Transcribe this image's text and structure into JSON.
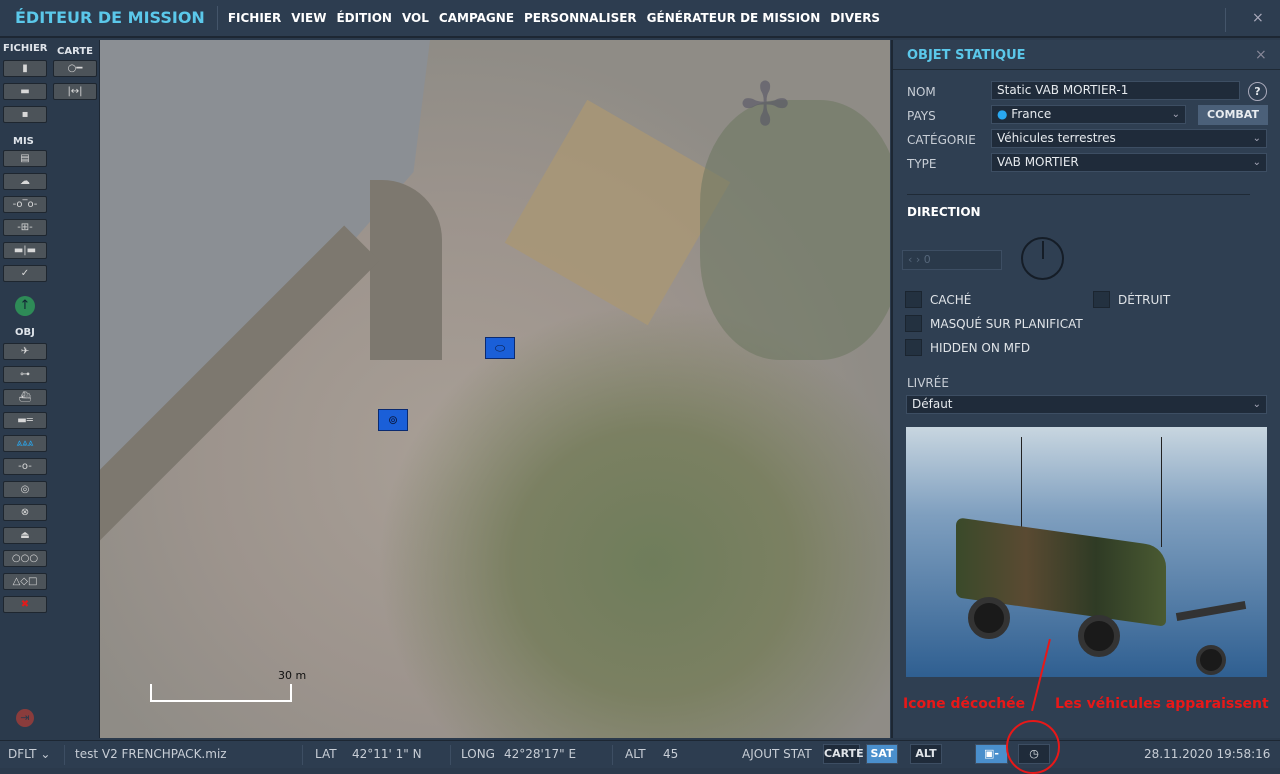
{
  "app": {
    "title": "ÉDITEUR DE MISSION",
    "close": "×"
  },
  "menu": [
    "FICHIER",
    "VIEW",
    "ÉDITION",
    "VOL",
    "CAMPAGNE",
    "PERSONNALISER",
    "GÉNÉRATEUR DE MISSION",
    "DIVERS"
  ],
  "toolbar": {
    "fichier_label": "FICHIER",
    "carte_label": "CARTE",
    "mis_label": "MIS",
    "obj_label": "OBJ",
    "fichier": [
      {
        "icon": "new-file-icon",
        "glyph": "▮"
      },
      {
        "icon": "open-folder-icon",
        "glyph": "▬"
      },
      {
        "icon": "save-icon",
        "glyph": "▪"
      }
    ],
    "carte": [
      {
        "icon": "key-icon",
        "glyph": "○━"
      },
      {
        "icon": "ruler-icon",
        "glyph": "|↔|"
      }
    ],
    "mis": [
      {
        "icon": "briefing-icon",
        "glyph": "▤"
      },
      {
        "icon": "weather-icon",
        "glyph": "☁"
      },
      {
        "icon": "trigger-icon",
        "glyph": "-o‾o-"
      },
      {
        "icon": "target-zone-icon",
        "glyph": "-⊞-"
      },
      {
        "icon": "flag-icon",
        "glyph": "▬|▬"
      },
      {
        "icon": "check-icon",
        "glyph": "✓"
      }
    ],
    "obj": [
      {
        "icon": "airplane-icon",
        "glyph": "✈"
      },
      {
        "icon": "helicopter-icon",
        "glyph": "⊶"
      },
      {
        "icon": "ship-icon",
        "glyph": "⛴"
      },
      {
        "icon": "tank-icon",
        "glyph": "▬═"
      },
      {
        "icon": "static-object-icon",
        "glyph": "⩓⩓⩓",
        "active": true
      },
      {
        "icon": "waypoint-icon",
        "glyph": "-o-"
      },
      {
        "icon": "zone-icon",
        "glyph": "◎"
      },
      {
        "icon": "nav-target-icon",
        "glyph": "⊗"
      },
      {
        "icon": "helipad-icon",
        "glyph": "⏏"
      },
      {
        "icon": "formation-icon",
        "glyph": "○○○"
      },
      {
        "icon": "shapes-icon",
        "glyph": "△◇□"
      },
      {
        "icon": "delete-icon",
        "glyph": "✖"
      }
    ]
  },
  "map": {
    "scale_label": "30 m"
  },
  "panel": {
    "title": "OBJET STATIQUE",
    "close": "×",
    "nom_label": "NOM",
    "nom_value": "Static VAB MORTIER-1",
    "help": "?",
    "pays_label": "PAYS",
    "pays_value": "France",
    "country_color": "#29a8f0",
    "combat_label": "COMBAT",
    "categorie_label": "CATÉGORIE",
    "categorie_value": "Véhicules terrestres",
    "type_label": "TYPE",
    "type_value": "VAB MORTIER",
    "direction_label": "DIRECTION",
    "direction_value": "0",
    "direction_arrows": "‹ ›",
    "checkboxes": [
      {
        "label": "CACHÉ",
        "checked": false
      },
      {
        "label": "DÉTRUIT",
        "checked": false
      },
      {
        "label": "MASQUÉ SUR PLANIFICAT",
        "checked": false
      },
      {
        "label": "HIDDEN ON MFD",
        "checked": false
      }
    ],
    "livree_label": "LIVRÉE",
    "livree_value": "Défaut"
  },
  "annotations": {
    "left": "Icone décochée",
    "right": "Les véhicules apparaissent",
    "color": "#e81818"
  },
  "status": {
    "profile": "DFLT",
    "file": "test V2 FRENCHPACK.miz",
    "lat_label": "LAT",
    "lat": "42°11' 1\" N",
    "long_label": "LONG",
    "long": "42°28'17\" E",
    "alt_label": "ALT",
    "alt": "45",
    "ajout_stat": "AJOUT STAT",
    "carte": "CARTE",
    "sat": "SAT",
    "alt_btn": "ALT",
    "active_view": "SAT",
    "datetime": "28.11.2020 19:58:16"
  }
}
